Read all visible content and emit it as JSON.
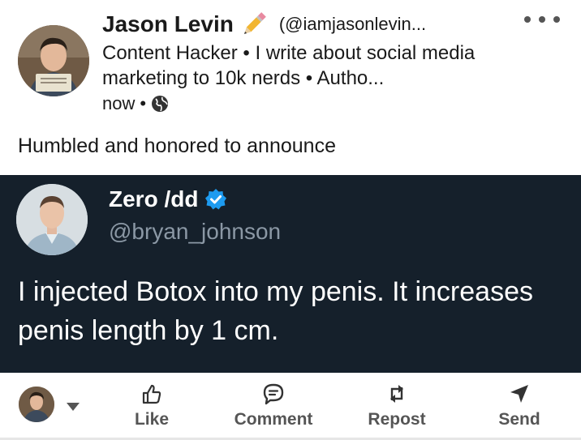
{
  "post": {
    "author": {
      "name": "Jason Levin",
      "name_emoji_icon": "pencil-icon",
      "handle": "(@iamjasonlevin...",
      "headline": "Content Hacker • I write about social media marketing to 10k nerds • Autho...",
      "time": "now",
      "separator": "•",
      "visibility_icon": "globe-icon"
    },
    "text": "Humbled and honored to announce"
  },
  "tweet": {
    "name": "Zero /dd",
    "verified_icon": "verified-badge-icon",
    "handle": "@bryan_johnson",
    "body": "I injected Botox into my penis.  It increases penis length by 1 cm."
  },
  "actions": {
    "like": "Like",
    "comment": "Comment",
    "repost": "Repost",
    "send": "Send"
  },
  "colors": {
    "tweet_background": "#15202b",
    "tweet_handle": "#8b98a5",
    "verified": "#1d9bf0",
    "action_label": "#555555"
  }
}
